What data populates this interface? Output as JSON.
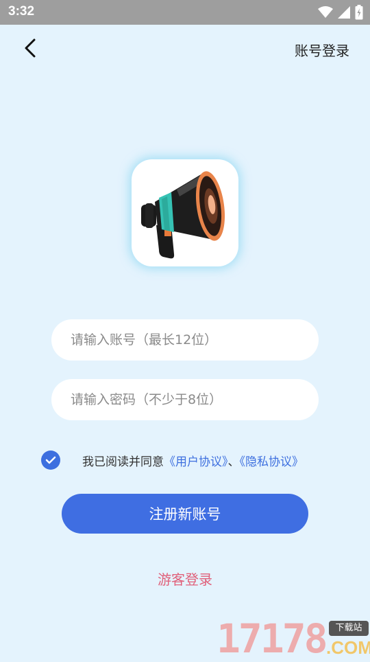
{
  "status_bar": {
    "time": "3:32"
  },
  "header": {
    "account_login": "账号登录"
  },
  "form": {
    "account_placeholder": "请输入账号（最长12位）",
    "password_placeholder": "请输入密码（不少于8位）",
    "agree_checked": true,
    "agree_prefix": "我已阅读并同意",
    "user_agreement": "《用户协议》",
    "separator": "、",
    "privacy_policy": "《隐私协议》",
    "register_label": "注册新账号",
    "guest_login": "游客登录"
  },
  "watermark": {
    "digits": "17178",
    "badge": "下载站",
    "domain": ".COM"
  },
  "colors": {
    "background": "#e4f3fd",
    "primary": "#3f6ee2",
    "guest": "#e0607a",
    "status_bar": "#9e9e9e"
  }
}
